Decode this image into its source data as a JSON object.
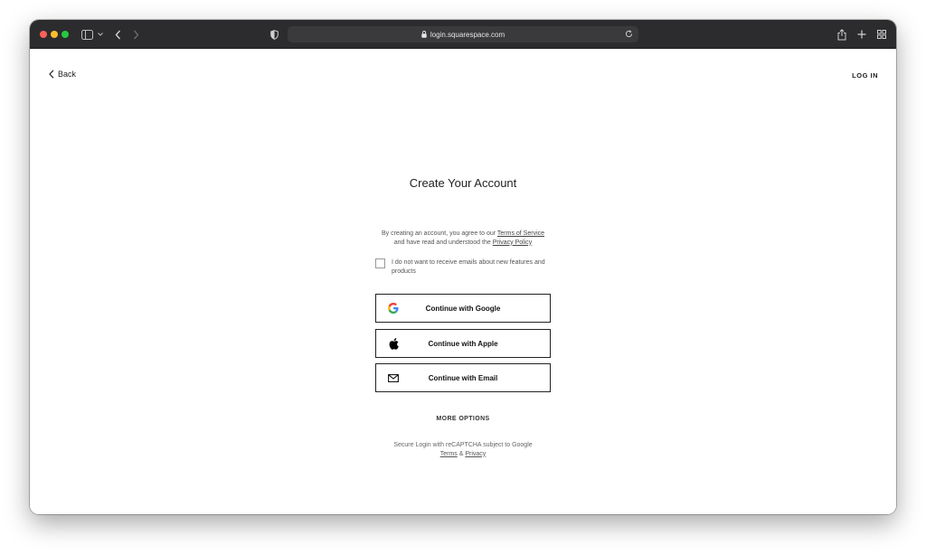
{
  "browser": {
    "url": "login.squarespace.com"
  },
  "nav": {
    "back_label": "Back",
    "login_label": "LOG IN"
  },
  "form": {
    "title": "Create Your Account",
    "terms_prefix": "By creating an account, you agree to our ",
    "terms_link": "Terms of Service",
    "terms_middle": "and have read and understood the ",
    "privacy_link": "Privacy Policy",
    "optout_label": "I do not want to receive emails about new features and products",
    "optout_checked": false,
    "google_button": "Continue with Google",
    "apple_button": "Continue with Apple",
    "email_button": "Continue with Email",
    "more_options": "MORE OPTIONS",
    "recaptcha_text": "Secure Login with reCAPTCHA subject to Google",
    "recaptcha_terms": "Terms",
    "recaptcha_amp": " & ",
    "recaptcha_privacy": "Privacy"
  },
  "colors": {
    "titlebar": "#2c2c2e",
    "text": "#222222",
    "border": "#222222"
  },
  "icons": [
    "sidebar-icon",
    "chevron-down-icon",
    "back-arrow-icon",
    "forward-arrow-icon",
    "shield-icon",
    "lock-icon",
    "reload-icon",
    "share-icon",
    "plus-icon",
    "tab-overview-icon",
    "google-icon",
    "apple-icon",
    "mail-icon"
  ]
}
